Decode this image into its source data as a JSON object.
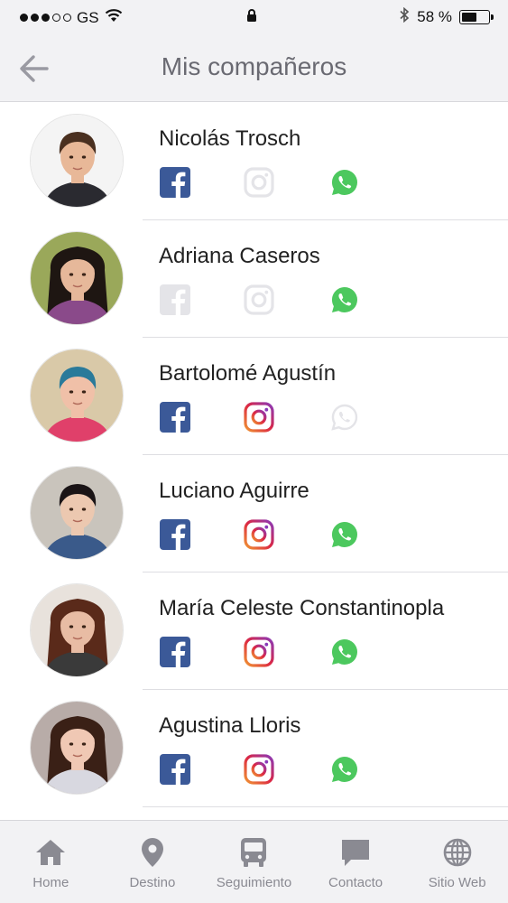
{
  "status_bar": {
    "carrier": "GS",
    "signal_bars_filled": 3,
    "signal_bars_total": 5,
    "battery_text": "58 %",
    "battery_level": 0.58
  },
  "nav": {
    "title": "Mis compañeros",
    "back_icon": "arrow-left-icon"
  },
  "colors": {
    "facebook": "#3b5998",
    "whatsapp": "#4cc85e",
    "disabled": "#e4e4e8",
    "instagram_from": "#f09433",
    "instagram_to": "#8a3ab9"
  },
  "classmates": [
    {
      "name": "Nicolás Trosch",
      "facebook": true,
      "instagram": false,
      "whatsapp": true
    },
    {
      "name": "Adriana Caseros",
      "facebook": false,
      "instagram": false,
      "whatsapp": true
    },
    {
      "name": "Bartolomé Agustín",
      "facebook": true,
      "instagram": true,
      "whatsapp": false
    },
    {
      "name": "Luciano Aguirre",
      "facebook": true,
      "instagram": true,
      "whatsapp": true
    },
    {
      "name": "María Celeste Constantinopla",
      "facebook": true,
      "instagram": true,
      "whatsapp": true
    },
    {
      "name": "Agustina Lloris",
      "facebook": true,
      "instagram": true,
      "whatsapp": true
    }
  ],
  "tabs": [
    {
      "label": "Home",
      "icon": "home-icon"
    },
    {
      "label": "Destino",
      "icon": "map-pin-icon"
    },
    {
      "label": "Seguimiento",
      "icon": "bus-icon"
    },
    {
      "label": "Contacto",
      "icon": "chat-bubble-icon"
    },
    {
      "label": "Sitio Web",
      "icon": "globe-icon"
    }
  ]
}
